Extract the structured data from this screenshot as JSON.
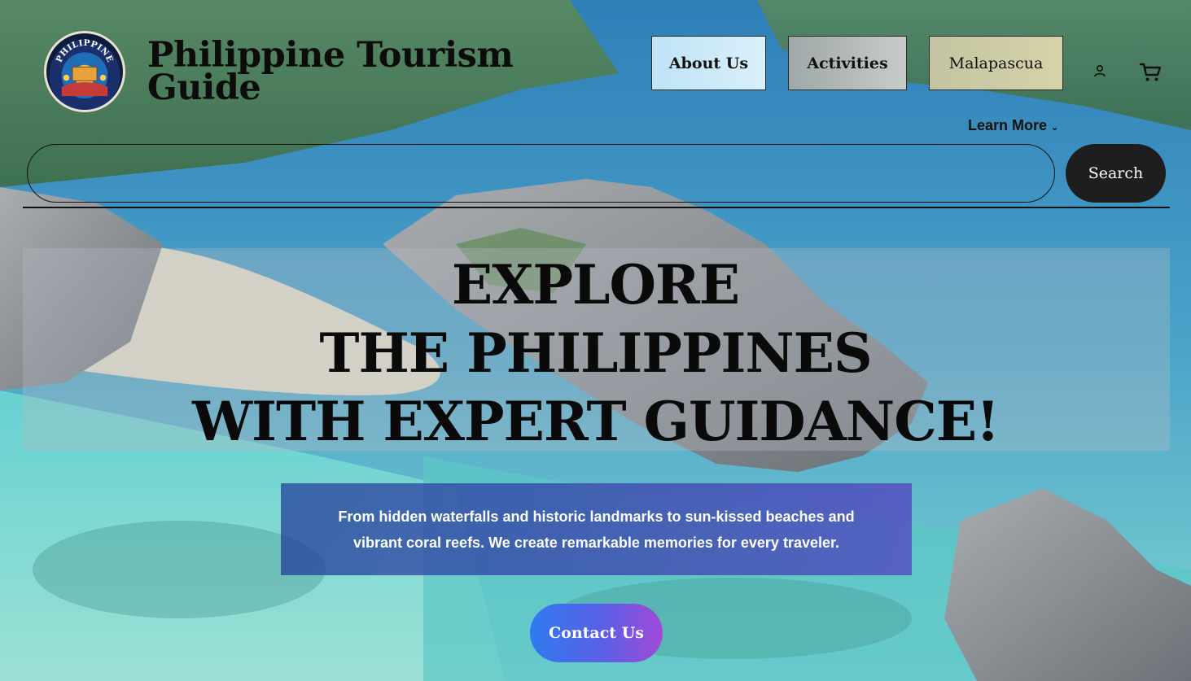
{
  "header": {
    "logo_text": "PHILIPPINE",
    "brand_line1": "Philippine Tourism",
    "brand_line2": "Guide"
  },
  "nav": {
    "about": "About Us",
    "activities": "Activities",
    "malapascua": "Malapascua",
    "learn_more": "Learn More",
    "account_icon": "person-icon",
    "cart_icon": "cart-icon"
  },
  "search": {
    "placeholder": "",
    "button": "Search"
  },
  "hero": {
    "line1": "EXPLORE",
    "line2": "THE PHILIPPINES",
    "line3": "WITH EXPERT GUIDANCE!",
    "subtitle": "From hidden waterfalls and historic landmarks to sun-kissed beaches and vibrant coral reefs. We create remarkable memories for every traveler.",
    "cta": "Contact Us"
  },
  "colors": {
    "sea": "#3f8fc0",
    "lagoon": "#5fd0cf",
    "cta_start": "#2f7bf0",
    "cta_end": "#a04ad8",
    "subtitle_bg": "#2a3fa0"
  }
}
